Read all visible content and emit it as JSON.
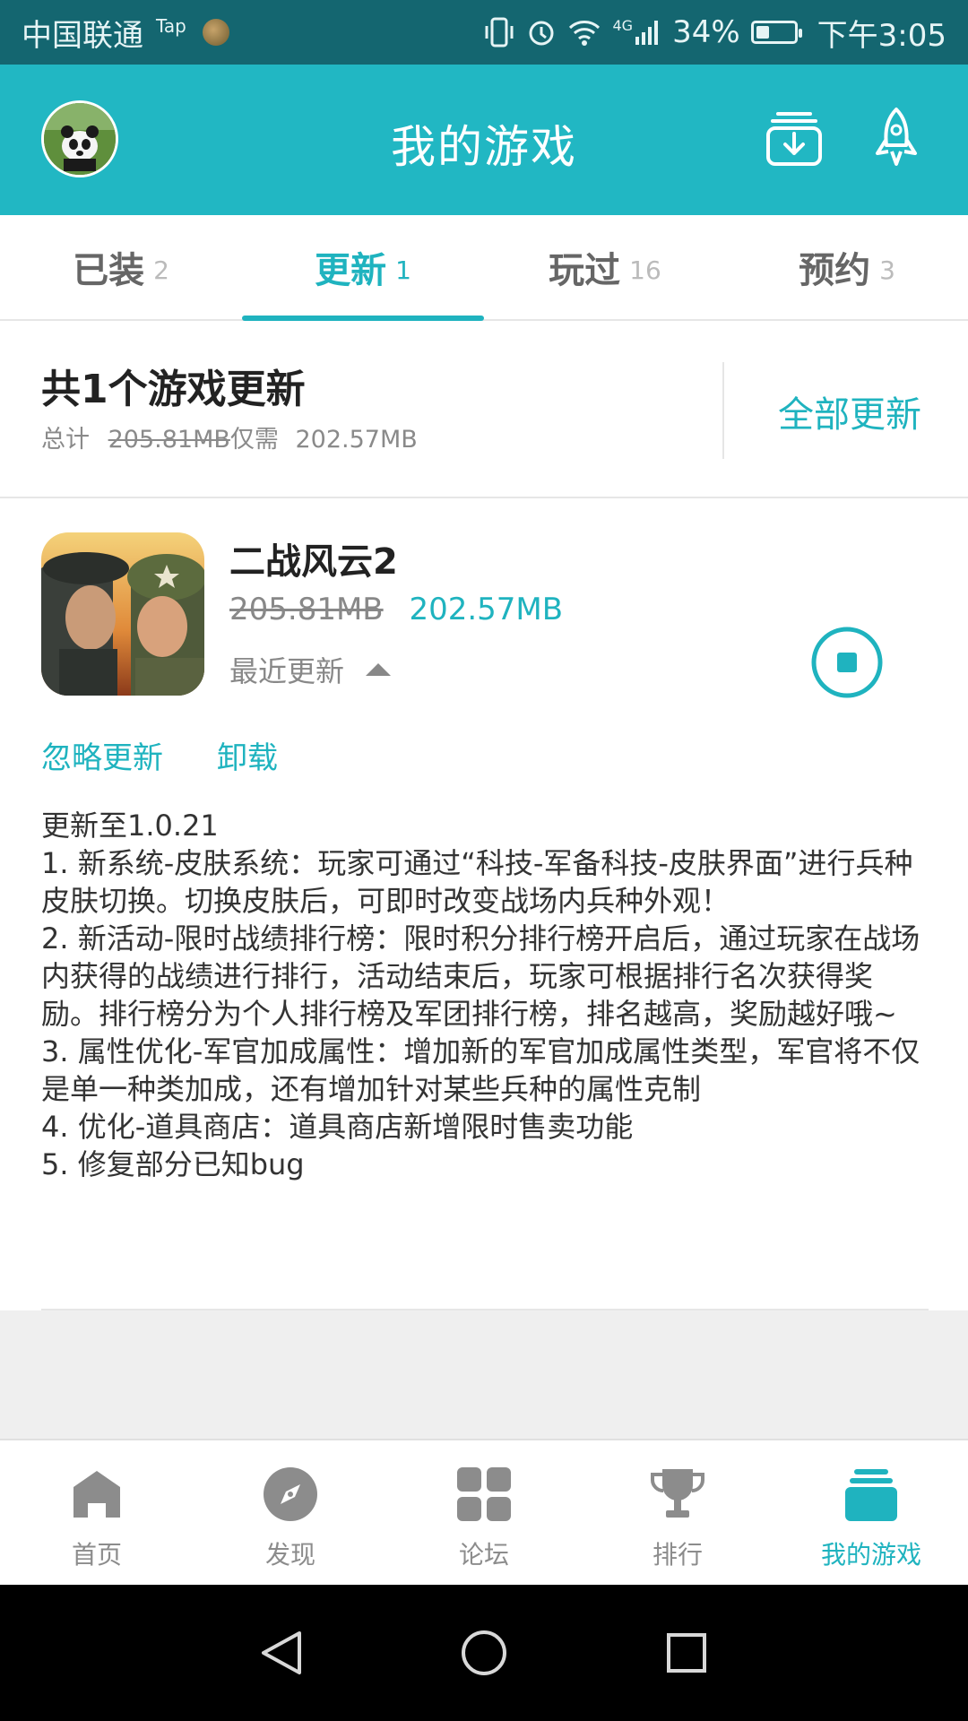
{
  "status_bar": {
    "carrier": "中国联通",
    "tap_tag": "Tap",
    "network": "4G",
    "battery_percent": "34%",
    "battery_level": 0.34,
    "time": "下午3:05"
  },
  "header": {
    "title": "我的游戏",
    "icons": [
      "profile-avatar",
      "download-manager-icon",
      "rocket-icon"
    ]
  },
  "tabs": [
    {
      "label": "已装",
      "count": "2"
    },
    {
      "label": "更新",
      "count": "1",
      "active": true
    },
    {
      "label": "玩过",
      "count": "16"
    },
    {
      "label": "预约",
      "count": "3"
    }
  ],
  "summary": {
    "title": "共1个游戏更新",
    "total_label": "总计",
    "original_size": "205.81MB",
    "only_need_label": "仅需",
    "required_size": "202.57MB",
    "update_all": "全部更新"
  },
  "game": {
    "name": "二战风云2",
    "old_size": "205.81MB",
    "new_size": "202.57MB",
    "recent_update": "最近更新",
    "ignore": "忽略更新",
    "uninstall": "卸载",
    "changelog_title": "更新至1.0.21",
    "changelog": [
      "1. 新系统-皮肤系统：玩家可通过“科技-军备科技-皮肤界面”进行兵种皮肤切换。切换皮肤后，可即时改变战场内兵种外观！",
      "2. 新活动-限时战绩排行榜：限时积分排行榜开启后，通过玩家在战场内获得的战绩进行排行，活动结束后，玩家可根据排行名次获得奖励。排行榜分为个人排行榜及军团排行榜，排名越高，奖励越好哦~",
      "3. 属性优化-军官加成属性：增加新的军官加成属性类型，军官将不仅是单一种类加成，还有增加针对某些兵种的属性克制",
      "4. 优化-道具商店：道具商店新增限时售卖功能",
      "5. 修复部分已知bug"
    ]
  },
  "bottom_nav": [
    {
      "label": "首页",
      "icon": "home-icon"
    },
    {
      "label": "发现",
      "icon": "compass-icon"
    },
    {
      "label": "论坛",
      "icon": "grid-icon"
    },
    {
      "label": "排行",
      "icon": "trophy-icon"
    },
    {
      "label": "我的游戏",
      "icon": "stack-icon",
      "active": true
    }
  ],
  "colors": {
    "accent": "#1fb3bf",
    "header": "#21b7c3",
    "status_bar": "#146670"
  }
}
